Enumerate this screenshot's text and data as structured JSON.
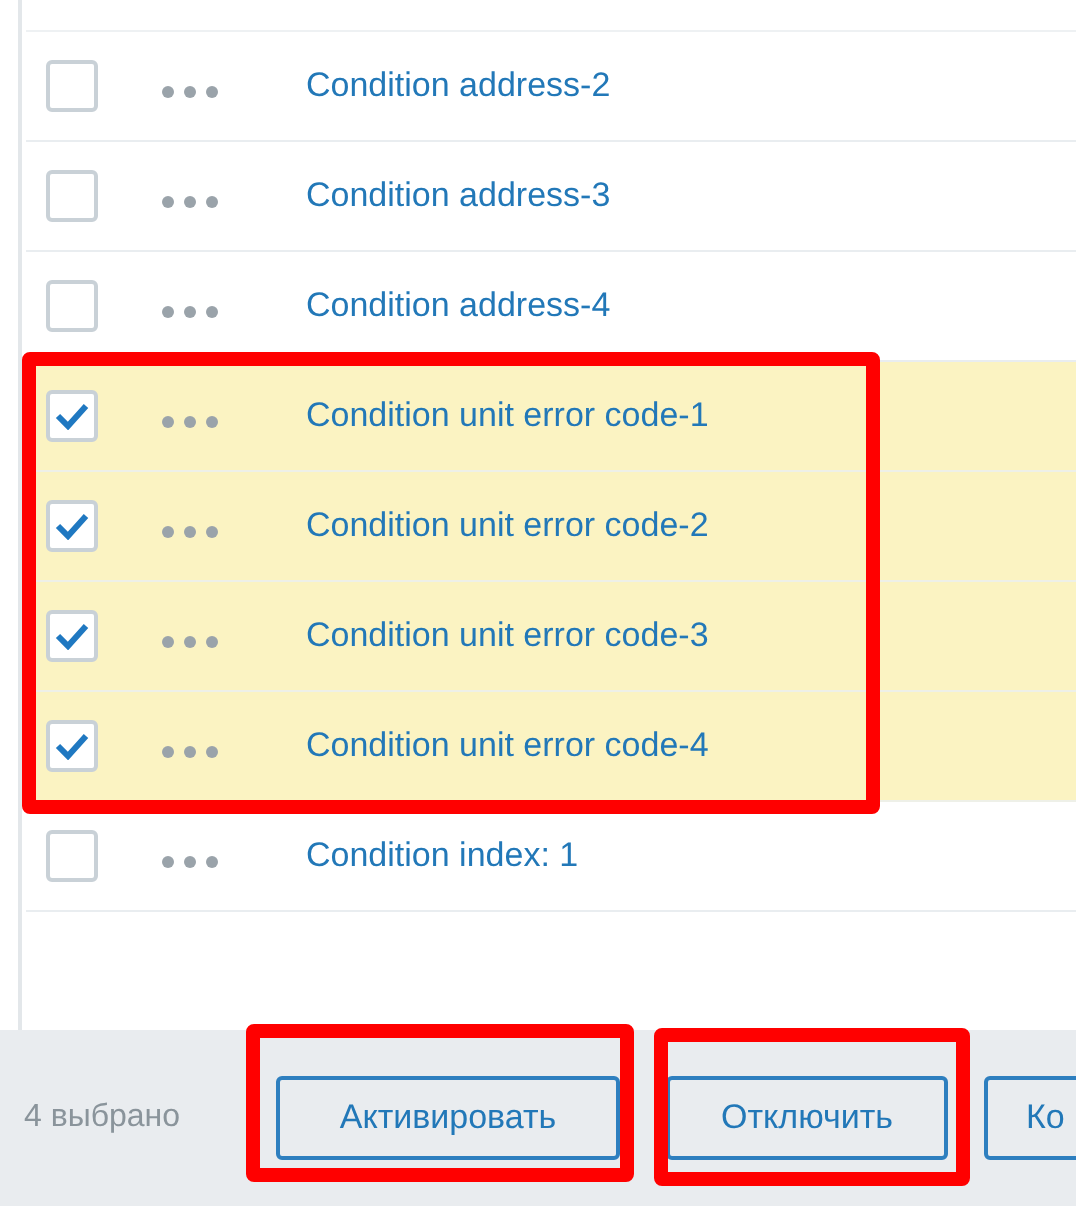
{
  "rows": [
    {
      "label": "Condition address-2",
      "checked": false
    },
    {
      "label": "Condition address-3",
      "checked": false
    },
    {
      "label": "Condition address-4",
      "checked": false
    },
    {
      "label": "Condition unit error code-1",
      "checked": true
    },
    {
      "label": "Condition unit error code-2",
      "checked": true
    },
    {
      "label": "Condition unit error code-3",
      "checked": true
    },
    {
      "label": "Condition unit error code-4",
      "checked": true
    },
    {
      "label": "Condition index: 1",
      "checked": false
    }
  ],
  "footer": {
    "selected_count": "4 выбрано",
    "buttons": [
      "Активировать",
      "Отключить",
      "Ко"
    ]
  }
}
